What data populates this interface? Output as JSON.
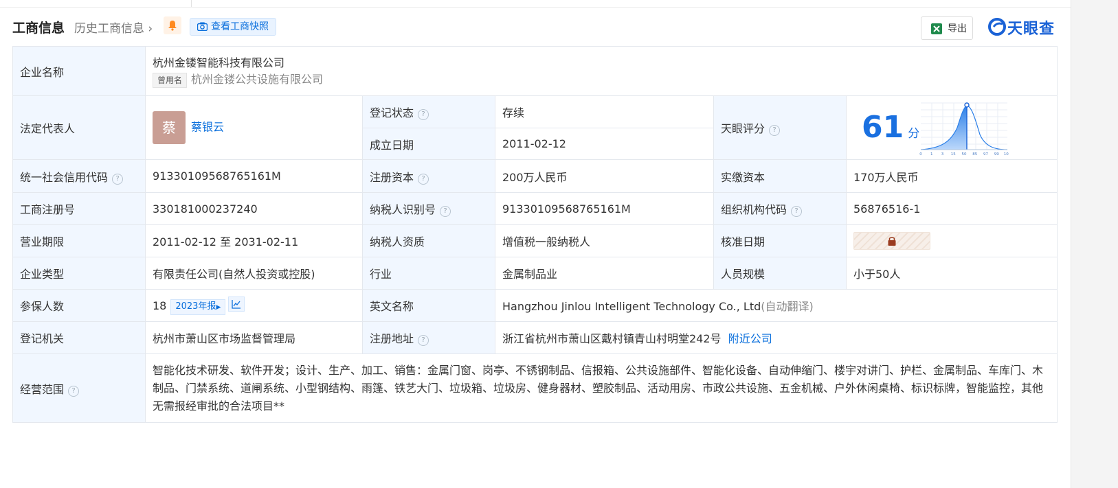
{
  "header": {
    "title": "工商信息",
    "history": "历史工商信息",
    "snapshot": "查看工商快照",
    "export": "导出",
    "brand": "天眼查"
  },
  "company": {
    "name_label": "企业名称",
    "name": "杭州金镂智能科技有限公司",
    "former_tag": "曾用名",
    "former_name": "杭州金镂公共设施有限公司"
  },
  "legal": {
    "label": "法定代表人",
    "avatar": "蔡",
    "name": "蔡银云"
  },
  "status": {
    "label": "登记状态",
    "value": "存续"
  },
  "founded": {
    "label": "成立日期",
    "value": "2011-02-12"
  },
  "score": {
    "label": "天眼评分",
    "value": "61",
    "unit": "分",
    "curve_ticks": [
      "0",
      "1",
      "3",
      "15",
      "50",
      "85",
      "97",
      "99",
      "100"
    ],
    "marker_at": 61
  },
  "credit": {
    "label": "统一社会信用代码",
    "value": "91330109568765161M"
  },
  "capital": {
    "label": "注册资本",
    "value": "200万人民币"
  },
  "paid": {
    "label": "实缴资本",
    "value": "170万人民币"
  },
  "regno": {
    "label": "工商注册号",
    "value": "330181000237240"
  },
  "taxid": {
    "label": "纳税人识别号",
    "value": "91330109568765161M"
  },
  "orgcode": {
    "label": "组织机构代码",
    "value": "56876516-1"
  },
  "term": {
    "label": "营业期限",
    "value": "2011-02-12 至 2031-02-11"
  },
  "taxqual": {
    "label": "纳税人资质",
    "value": "增值税一般纳税人"
  },
  "approve": {
    "label": "核准日期"
  },
  "type": {
    "label": "企业类型",
    "value": "有限责任公司(自然人投资或控股)"
  },
  "industry": {
    "label": "行业",
    "value": "金属制品业"
  },
  "staff": {
    "label": "人员规模",
    "value": "小于50人"
  },
  "insured": {
    "label": "参保人数",
    "value": "18",
    "report": "2023年报"
  },
  "english": {
    "label": "英文名称",
    "value": "Hangzhou Jinlou Intelligent Technology Co., Ltd",
    "note": "(自动翻译)"
  },
  "authority": {
    "label": "登记机关",
    "value": "杭州市萧山区市场监督管理局"
  },
  "address": {
    "label": "注册地址",
    "value": "浙江省杭州市萧山区戴村镇青山村明堂242号",
    "nearby": "附近公司"
  },
  "scope": {
    "label": "经营范围",
    "value": "智能化技术研发、软件开发；设计、生产、加工、销售：金属门窗、岗亭、不锈钢制品、信报箱、公共设施部件、智能化设备、自动伸缩门、楼宇对讲门、护栏、金属制品、车库门、木制品、门禁系统、道闸系统、小型钢结构、雨篷、铁艺大门、垃圾箱、垃圾房、健身器材、塑胶制品、活动用房、市政公共设施、五金机械、户外休闲桌椅、标识标牌，智能监控，其他无需报经审批的合法项目**"
  },
  "colors": {
    "accent": "#0a6fdc",
    "label_bg": "#f1f7ff",
    "status_green": "#1a9c3f"
  }
}
